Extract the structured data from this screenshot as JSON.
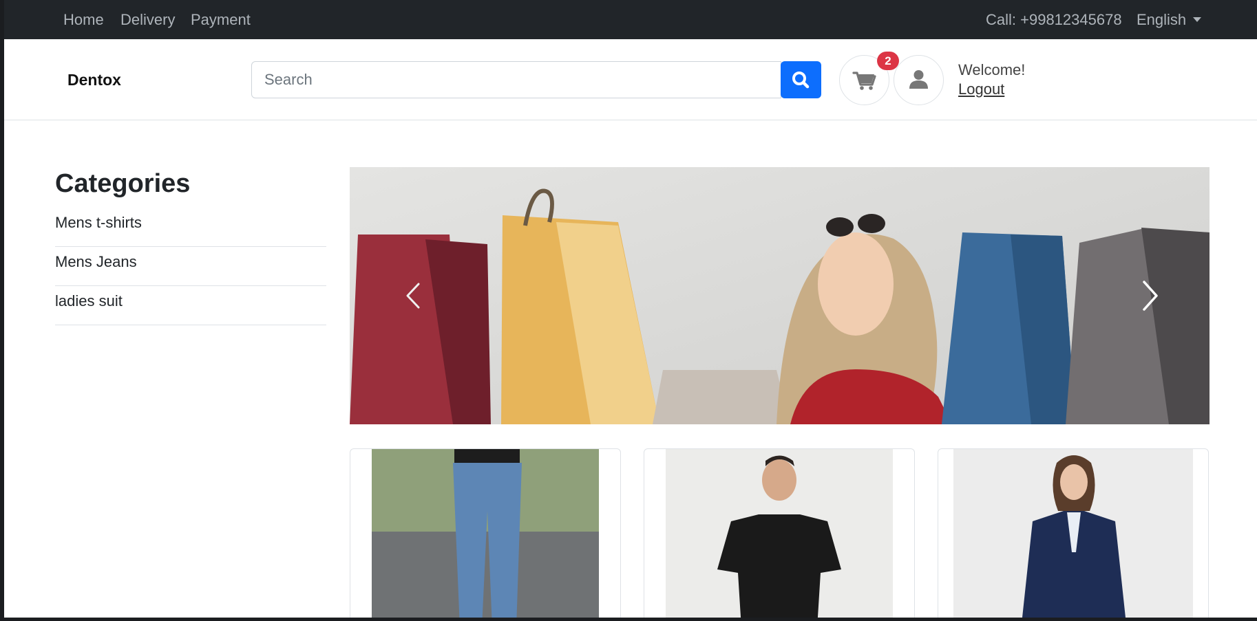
{
  "topnav": {
    "links": [
      "Home",
      "Delivery",
      "Payment"
    ],
    "phone": "Call: +99812345678",
    "language": "English"
  },
  "header": {
    "brand": "Dentox",
    "search_placeholder": "Search",
    "cart_count": "2",
    "welcome": "Welcome!",
    "logout": "Logout"
  },
  "sidebar": {
    "title": "Categories",
    "items": [
      "Mens t-shirts",
      "Mens Jeans",
      "ladies suit"
    ]
  },
  "colors": {
    "topbar": "#212529",
    "primary": "#0d6efd",
    "badge": "#dc3545"
  },
  "icons": [
    "search-icon",
    "cart-icon",
    "user-icon",
    "chevron-left-icon",
    "chevron-right-icon",
    "caret-down-icon"
  ]
}
